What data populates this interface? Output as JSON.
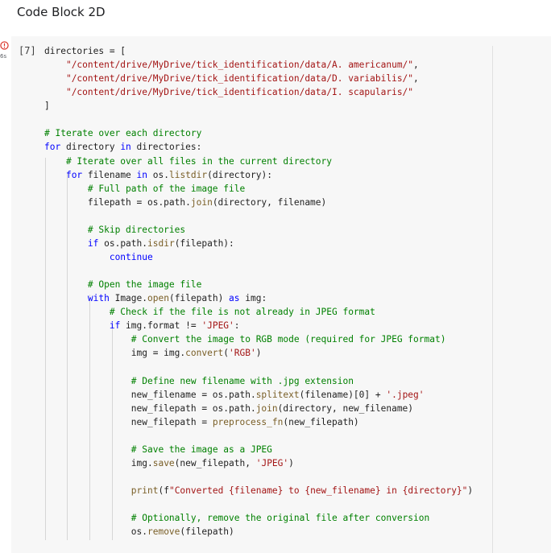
{
  "heading": "Code Block 2D",
  "cell": {
    "execution_count": "[7]",
    "run_time": "6s",
    "status_color": "#d93025",
    "lines": [
      "directories = [",
      "    \"/content/drive/MyDrive/tick_identification/data/A. americanum/\",",
      "    \"/content/drive/MyDrive/tick_identification/data/D. variabilis/\",",
      "    \"/content/drive/MyDrive/tick_identification/data/I. scapularis/\"",
      "]",
      "",
      "# Iterate over each directory",
      "for directory in directories:",
      "    # Iterate over all files in the current directory",
      "    for filename in os.listdir(directory):",
      "        # Full path of the image file",
      "        filepath = os.path.join(directory, filename)",
      "",
      "        # Skip directories",
      "        if os.path.isdir(filepath):",
      "            continue",
      "",
      "        # Open the image file",
      "        with Image.open(filepath) as img:",
      "            # Check if the file is not already in JPEG format",
      "            if img.format != 'JPEG':",
      "                # Convert the image to RGB mode (required for JPEG format)",
      "                img = img.convert('RGB')",
      "",
      "                # Define new filename with .jpg extension",
      "                new_filename = os.path.splitext(filename)[0] + '.jpeg'",
      "                new_filepath = os.path.join(directory, new_filename)",
      "                new_filepath = preprocess_fn(new_filepath)",
      "",
      "                # Save the image as a JPEG",
      "                img.save(new_filepath, 'JPEG')",
      "",
      "                print(f\"Converted {filename} to {new_filename} in {directory}\")",
      "",
      "                # Optionally, remove the original file after conversion",
      "                os.remove(filepath)"
    ]
  }
}
